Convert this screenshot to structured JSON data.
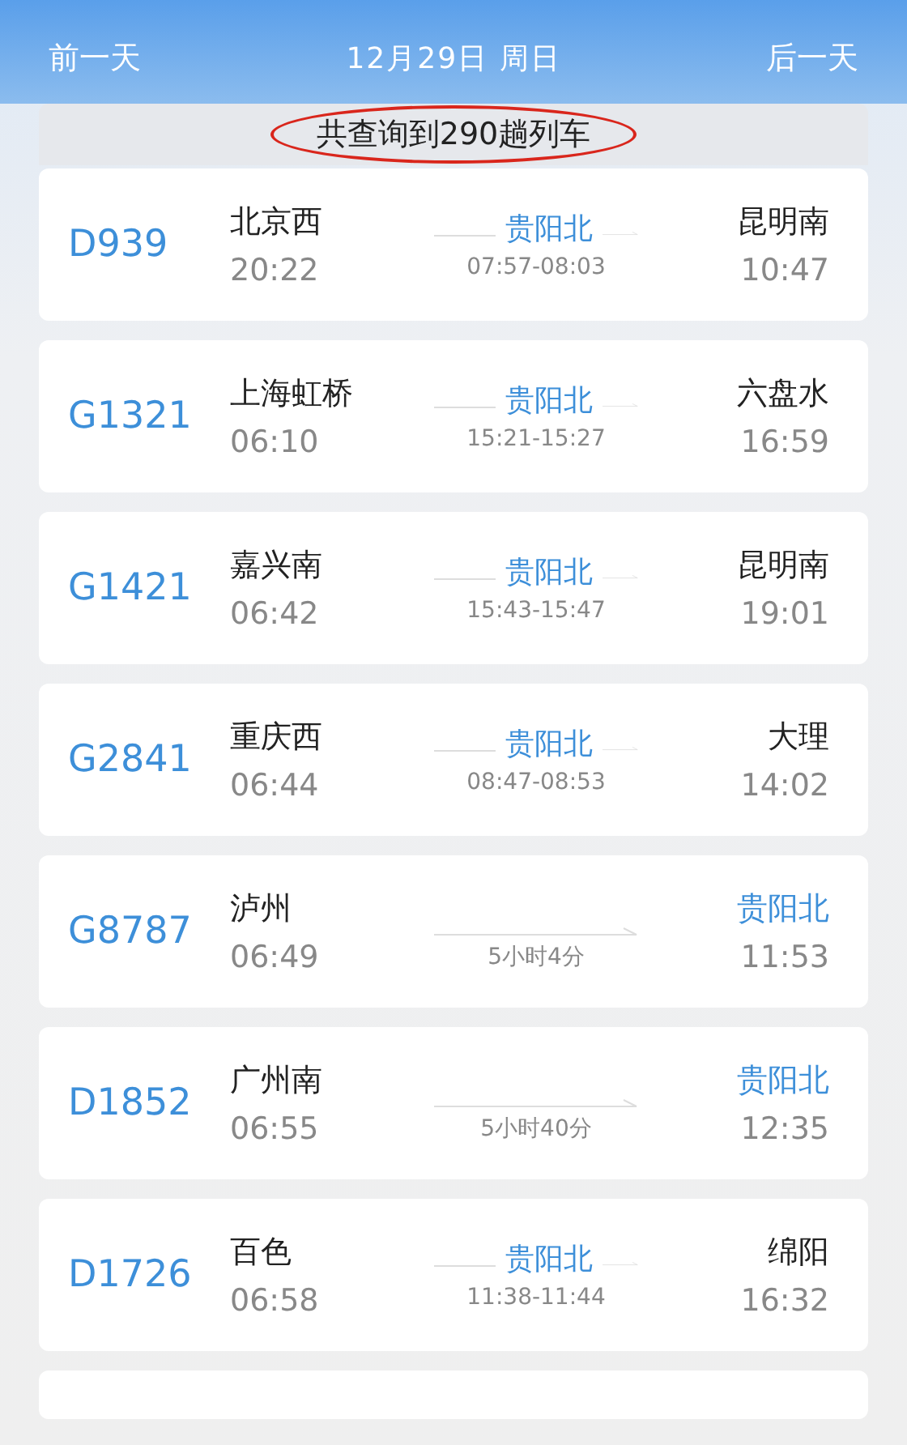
{
  "header": {
    "prev_day": "前一天",
    "date": "12月29日 周日",
    "next_day": "后一天"
  },
  "result_banner": "共查询到290趟列车",
  "trains": [
    {
      "number": "D939",
      "from": "北京西",
      "depart": "20:22",
      "kind": "via",
      "via": "贵阳北",
      "via_times": "07:57-08:03",
      "to": "昆明南",
      "arrive": "10:47"
    },
    {
      "number": "G1321",
      "from": "上海虹桥",
      "depart": "06:10",
      "kind": "via",
      "via": "贵阳北",
      "via_times": "15:21-15:27",
      "to": "六盘水",
      "arrive": "16:59"
    },
    {
      "number": "G1421",
      "from": "嘉兴南",
      "depart": "06:42",
      "kind": "via",
      "via": "贵阳北",
      "via_times": "15:43-15:47",
      "to": "昆明南",
      "arrive": "19:01"
    },
    {
      "number": "G2841",
      "from": "重庆西",
      "depart": "06:44",
      "kind": "via",
      "via": "贵阳北",
      "via_times": "08:47-08:53",
      "to": "大理",
      "arrive": "14:02"
    },
    {
      "number": "G8787",
      "from": "泸州",
      "depart": "06:49",
      "kind": "direct",
      "duration": "5小时4分",
      "to": "贵阳北",
      "arrive": "11:53"
    },
    {
      "number": "D1852",
      "from": "广州南",
      "depart": "06:55",
      "kind": "direct",
      "duration": "5小时40分",
      "to": "贵阳北",
      "arrive": "12:35"
    },
    {
      "number": "D1726",
      "from": "百色",
      "depart": "06:58",
      "kind": "via",
      "via": "贵阳北",
      "via_times": "11:38-11:44",
      "to": "绵阳",
      "arrive": "16:32"
    }
  ]
}
